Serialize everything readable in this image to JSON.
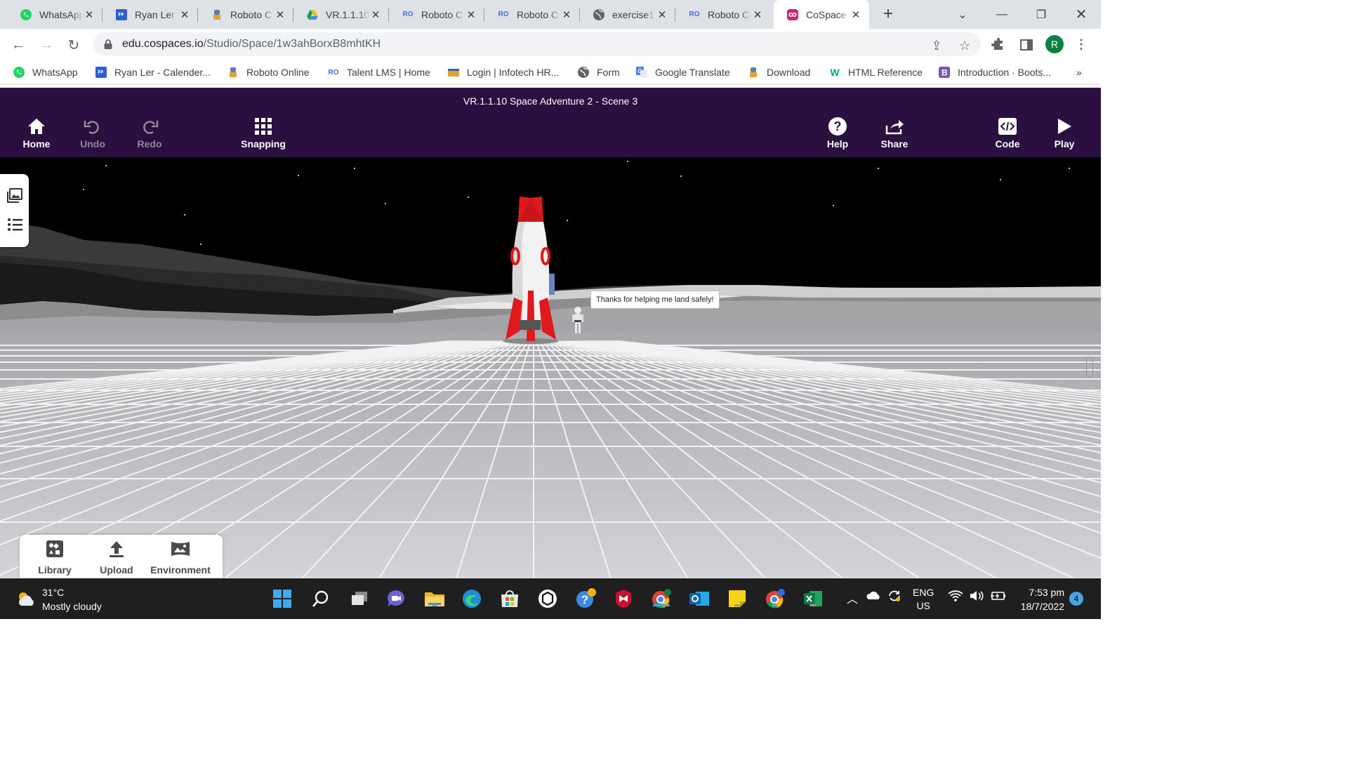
{
  "browser": {
    "tabs": [
      {
        "title": "WhatsApp",
        "icon": "whatsapp-icon"
      },
      {
        "title": "Ryan Ler",
        "icon": "calendar-icon"
      },
      {
        "title": "Roboto C",
        "icon": "roboto-icon"
      },
      {
        "title": "VR.1.1.10",
        "icon": "google-drive-icon"
      },
      {
        "title": "Roboto C",
        "icon": "roboto-coding-icon"
      },
      {
        "title": "Roboto C",
        "icon": "roboto-coding-icon"
      },
      {
        "title": "exercise1",
        "icon": "globe-icon"
      },
      {
        "title": "Roboto C",
        "icon": "roboto-coding-icon"
      },
      {
        "title": "CoSpace",
        "icon": "cospaces-icon",
        "active": true
      }
    ],
    "url_host": "edu.cospaces.io",
    "url_path": "/Studio/Space/1w3ahBorxB8mhtKH",
    "profile_initial": "R",
    "bookmarks": [
      {
        "label": "WhatsApp",
        "icon": "whatsapp-icon"
      },
      {
        "label": "Ryan Ler - Calender...",
        "icon": "calendar-icon"
      },
      {
        "label": "Roboto Online",
        "icon": "roboto-icon"
      },
      {
        "label": "Talent LMS | Home",
        "icon": "roboto-coding-icon"
      },
      {
        "label": "Login | Infotech HR...",
        "icon": "infotech-icon"
      },
      {
        "label": "Form",
        "icon": "globe-icon"
      },
      {
        "label": "Google Translate",
        "icon": "translate-icon"
      },
      {
        "label": "Download",
        "icon": "roboto-icon"
      },
      {
        "label": "HTML Reference",
        "icon": "w3schools-icon"
      },
      {
        "label": "Introduction · Boots...",
        "icon": "bootstrap-icon"
      }
    ],
    "bookmarks_more": "»"
  },
  "app": {
    "scene_title": "VR.1.1.10 Space Adventure 2 - Scene 3",
    "toolbar": {
      "home": "Home",
      "undo": "Undo",
      "redo": "Redo",
      "snapping": "Snapping",
      "help": "Help",
      "share": "Share",
      "code": "Code",
      "play": "Play"
    },
    "speech_bubble": "Thanks for helping me land safely!",
    "bottom": {
      "library": "Library",
      "upload": "Upload",
      "environment": "Environment"
    },
    "colors": {
      "appbar": "#2a0f40",
      "rocket_red": "#e0191c"
    }
  },
  "taskbar": {
    "weather_temp": "31°C",
    "weather_desc": "Mostly cloudy",
    "language": "ENG",
    "region": "US",
    "time": "7:53 pm",
    "date": "18/7/2022",
    "notifications": "4"
  }
}
